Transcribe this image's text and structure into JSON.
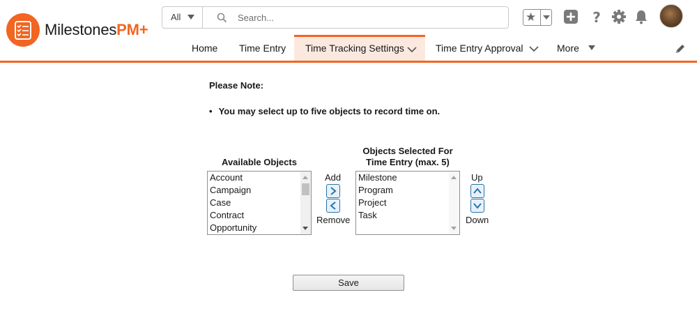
{
  "app": {
    "logo_text": "Milestones",
    "logo_accent": "PM+",
    "brand_color": "#f26522"
  },
  "search": {
    "scope": "All",
    "placeholder": "Search..."
  },
  "header_icons": [
    "star-icon",
    "add-icon",
    "help-icon",
    "gear-icon",
    "bell-icon",
    "avatar"
  ],
  "nav": {
    "items": [
      {
        "label": "Home",
        "dropdown": false,
        "active": false
      },
      {
        "label": "Time Entry",
        "dropdown": false,
        "active": false
      },
      {
        "label": "Time Tracking Settings",
        "dropdown": true,
        "active": true
      },
      {
        "label": "Time Entry Approval",
        "dropdown": true,
        "active": false
      },
      {
        "label": "More",
        "dropdown": true,
        "active": false
      }
    ]
  },
  "note": {
    "title": "Please Note:",
    "items": [
      "You may select up to five objects to record time on."
    ]
  },
  "available": {
    "heading": "Available Objects",
    "options": [
      "Account",
      "Campaign",
      "Case",
      "Contract",
      "Opportunity"
    ]
  },
  "selected": {
    "heading_line1": "Objects Selected For",
    "heading_line2": "Time Entry (max. 5)",
    "options": [
      "Milestone",
      "Program",
      "Project",
      "Task"
    ]
  },
  "controls": {
    "add_label": "Add",
    "remove_label": "Remove",
    "up_label": "Up",
    "down_label": "Down"
  },
  "save_label": "Save"
}
